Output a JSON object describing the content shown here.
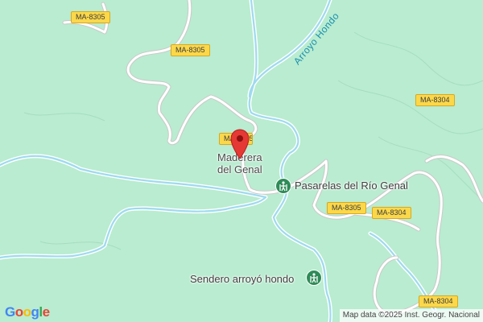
{
  "map": {
    "roads": [
      {
        "ref": "MA-8305"
      },
      {
        "ref": "MA-8305"
      },
      {
        "ref": "MA-8305"
      },
      {
        "ref": "MA-8304"
      },
      {
        "ref": "MA-8304"
      },
      {
        "ref": "MA-8304"
      }
    ],
    "river_label": "Arroyo Hondo",
    "place_label_line1": "Maderera",
    "place_label_line2": "del Genal",
    "pois": [
      {
        "name": "Pasarelas del Río Genal",
        "icon": "hiking-icon"
      },
      {
        "name": "Sendero arroyó hondo",
        "icon": "hiking-icon"
      }
    ],
    "marker_icon": "map-pin-icon",
    "colors": {
      "land": "#b9ecd0",
      "water": "#9edaf0",
      "river_stroke": "#ffffff",
      "road": "#ffffff",
      "shield": "#fbd84a",
      "pin": "#e53935"
    }
  },
  "footer": {
    "logo": "Google",
    "attribution": "Map data ©2025 Inst. Geogr. Nacional"
  }
}
